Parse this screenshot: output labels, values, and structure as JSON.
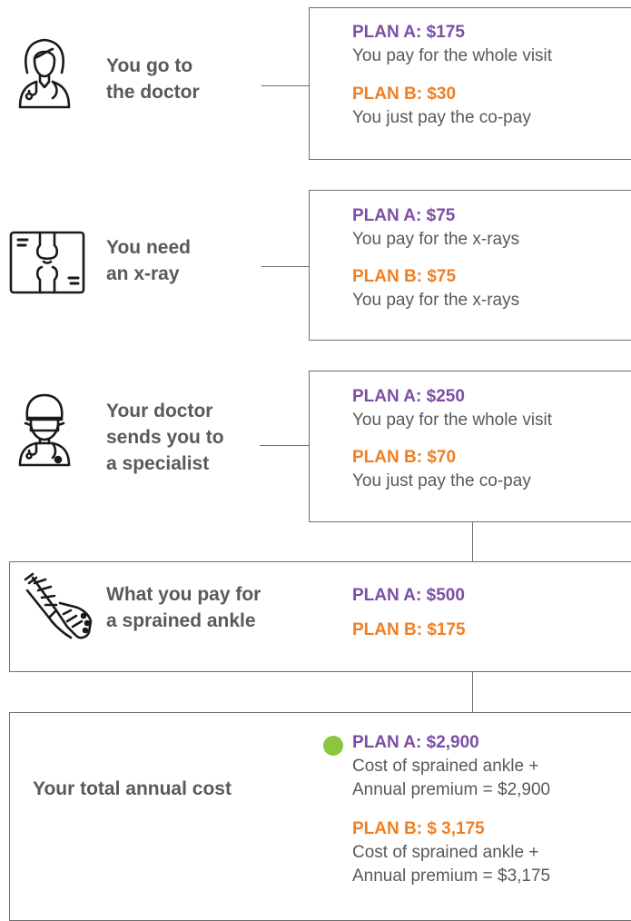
{
  "steps": [
    {
      "label_lines": [
        "You go to",
        "the doctor"
      ],
      "icon": "doctor-icon",
      "plan_a": {
        "title": "PLAN A:  $175",
        "desc": "You pay for the whole visit"
      },
      "plan_b": {
        "title": "PLAN B:  $30",
        "desc": "You just pay the co-pay"
      }
    },
    {
      "label_lines": [
        "You need",
        "an x-ray"
      ],
      "icon": "xray-icon",
      "plan_a": {
        "title": "PLAN A: $75",
        "desc": "You pay for the x-rays"
      },
      "plan_b": {
        "title": "PLAN B:  $75",
        "desc": "You pay for the x-rays"
      }
    },
    {
      "label_lines": [
        "Your doctor",
        "sends you to",
        "a specialist"
      ],
      "icon": "specialist-icon",
      "plan_a": {
        "title": "PLAN A:  $250",
        "desc": "You pay for the whole visit"
      },
      "plan_b": {
        "title": "PLAN B:  $70",
        "desc": "You just pay the co-pay"
      }
    }
  ],
  "ankle": {
    "label_lines": [
      "What you pay for",
      "a sprained ankle"
    ],
    "icon": "cast-leg-icon",
    "plan_a": "PLAN A:  $500",
    "plan_b": "PLAN B:  $175"
  },
  "total": {
    "label": "Your total annual cost",
    "plan_a": {
      "title": "PLAN A:  $2,900",
      "desc_lines": [
        "Cost of sprained ankle +",
        "Annual premium = $2,900"
      ]
    },
    "plan_b": {
      "title": "PLAN B:  $ 3,175",
      "desc_lines": [
        "Cost of sprained ankle +",
        "Annual premium = $3,175"
      ]
    },
    "indicator_color": "#8cc63f"
  },
  "colors": {
    "plan_a": "#7b4fa3",
    "plan_b": "#f07f22",
    "text": "#58595b",
    "line": "#6d6e71"
  }
}
